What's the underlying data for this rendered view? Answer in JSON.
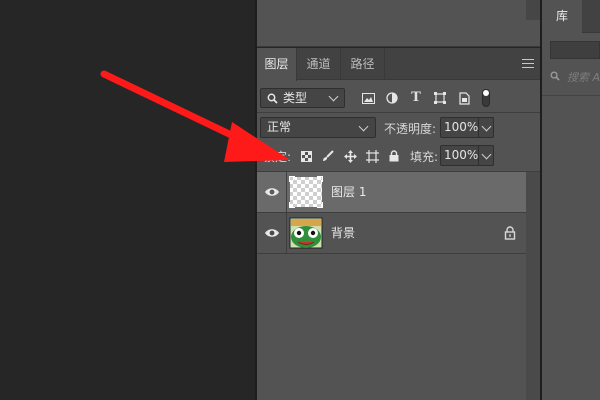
{
  "colors": {
    "arrow": "#ff1a1a",
    "panel_bg": "#535353",
    "selected_row": "#6a6a6a",
    "dark_bg": "#262626"
  },
  "layers_panel": {
    "tabs": [
      {
        "label": "图层",
        "active": true
      },
      {
        "label": "通道",
        "active": false
      },
      {
        "label": "路径",
        "active": false
      }
    ],
    "menu_icon": "hamburger-menu-icon",
    "filter": {
      "icon": "search-icon",
      "kind": "类型",
      "filter_icons": [
        "image-filter-icon",
        "adjustment-filter-icon",
        "type-filter-icon",
        "shape-filter-icon",
        "smart-object-filter-icon",
        "filter-toggle-icon"
      ]
    },
    "blend_mode": "正常",
    "opacity_label": "不透明度:",
    "opacity_value": "100%",
    "lock_label": "锁定:",
    "lock_icons": [
      "lock-transparent-pixels-icon",
      "lock-image-pixels-icon",
      "lock-position-icon",
      "lock-artboard-icon",
      "lock-all-icon"
    ],
    "fill_label": "填充:",
    "fill_value": "100%",
    "layers": [
      {
        "name": "图层 1",
        "visible": true,
        "selected": true,
        "thumbnail": "transparent-checkerboard",
        "locked": false
      },
      {
        "name": "背景",
        "visible": true,
        "selected": false,
        "thumbnail": "frog-image",
        "locked": true
      }
    ]
  },
  "library_panel": {
    "tab": "库",
    "search_placeholder": "搜索 A"
  }
}
